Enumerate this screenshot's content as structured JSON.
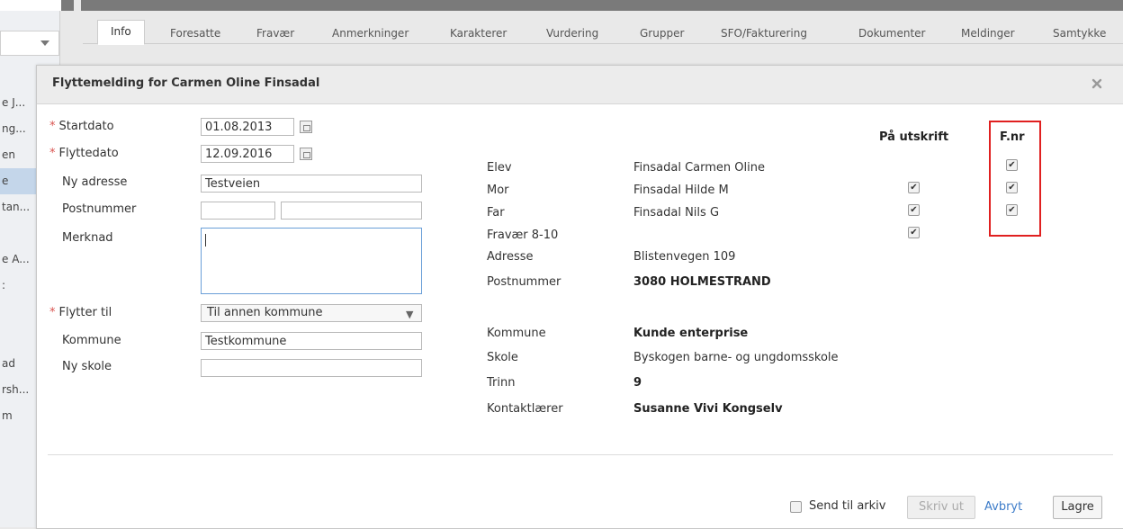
{
  "left_panel": {
    "items": [
      "e J...",
      "ng...",
      "en",
      "e",
      "tan...",
      "",
      "e A...",
      ":",
      "",
      "",
      "ad",
      "rsh...",
      "m"
    ]
  },
  "tabs": [
    {
      "label": "Info",
      "active": true
    },
    {
      "label": "Foresatte"
    },
    {
      "label": "Fravær"
    },
    {
      "label": "Anmerkninger"
    },
    {
      "label": "Karakterer"
    },
    {
      "label": "Vurdering"
    },
    {
      "label": "Grupper"
    },
    {
      "label": "SFO/Fakturering"
    },
    {
      "label": "Dokumenter"
    },
    {
      "label": "Meldinger"
    },
    {
      "label": "Samtykke"
    }
  ],
  "dialog": {
    "title": "Flyttemelding for Carmen Oline Finsadal",
    "close_icon": "close-icon"
  },
  "form": {
    "required_marker": "*",
    "startdato_label": "Startdato",
    "startdato_value": "01.08.2013",
    "flyttedato_label": "Flyttedato",
    "flyttedato_value": "12.09.2016",
    "ny_adresse_label": "Ny adresse",
    "ny_adresse_value": "Testveien",
    "postnummer_label": "Postnummer",
    "postnummer_value": "",
    "poststed_value": "",
    "merknad_label": "Merknad",
    "merknad_value": "",
    "flytter_til_label": "Flytter til",
    "flytter_til_value": "Til annen kommune",
    "kommune_label": "Kommune",
    "kommune_value": "Testkommune",
    "ny_skole_label": "Ny skole",
    "ny_skole_value": ""
  },
  "info": {
    "col_print": "På utskrift",
    "col_fnr": "F.nr",
    "rows": [
      {
        "label": "Elev",
        "value": "Finsadal Carmen Oline",
        "bold": false,
        "print": null,
        "fnr": true
      },
      {
        "label": "Mor",
        "value": "Finsadal Hilde M",
        "bold": false,
        "print": true,
        "fnr": true
      },
      {
        "label": "Far",
        "value": "Finsadal Nils G",
        "bold": false,
        "print": true,
        "fnr": true
      },
      {
        "label": "Fravær 8-10",
        "value": "",
        "bold": false,
        "print": true,
        "fnr": null
      },
      {
        "label": "Adresse",
        "value": "Blistenvegen 109",
        "bold": false,
        "print": null,
        "fnr": null
      },
      {
        "label": "Postnummer",
        "value": "3080 HOLMESTRAND",
        "bold": true,
        "print": null,
        "fnr": null
      },
      {
        "label": "Kommune",
        "value": "Kunde enterprise",
        "bold": true,
        "print": null,
        "fnr": null
      },
      {
        "label": "Skole",
        "value": "Byskogen barne- og ungdomsskole",
        "bold": false,
        "print": null,
        "fnr": null
      },
      {
        "label": "Trinn",
        "value": "9",
        "bold": true,
        "print": null,
        "fnr": null
      },
      {
        "label": "Kontaktlærer",
        "value": "Susanne Vivi Kongselv",
        "bold": true,
        "print": null,
        "fnr": null
      }
    ]
  },
  "footer": {
    "send_til_arkiv_label": "Send til arkiv",
    "send_til_arkiv_checked": false,
    "skriv_ut_label": "Skriv ut",
    "avbryt_label": "Avbryt",
    "lagre_label": "Lagre"
  },
  "colors": {
    "highlight_border": "#e02020",
    "link": "#3d7cc9",
    "required": "#d9534f",
    "focus_border": "#6a9fd8"
  }
}
